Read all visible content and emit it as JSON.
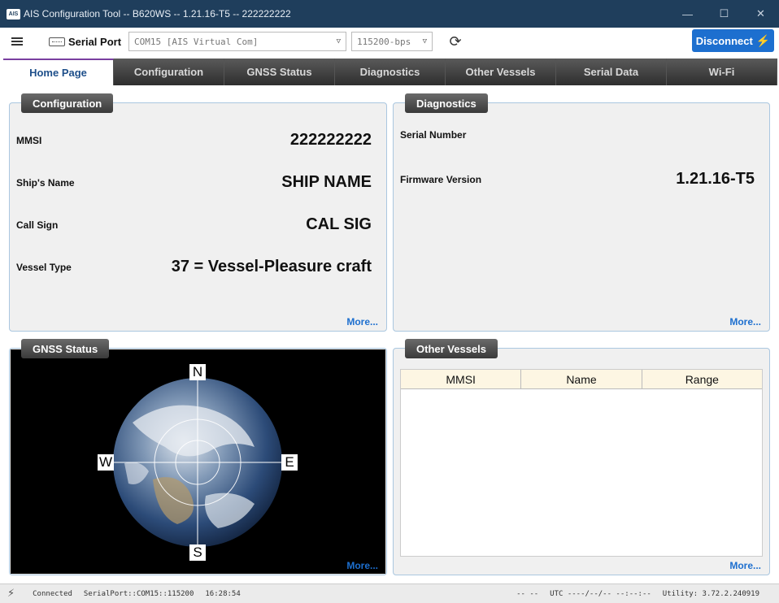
{
  "window": {
    "badge": "AIS",
    "title": "AIS Configuration Tool -- B620WS -- 1.21.16-T5 -- 222222222",
    "minimize": "—",
    "maximize": "☐",
    "close": "✕"
  },
  "toolbar": {
    "port_label": "Serial Port",
    "port_value": "COM15 [AIS Virtual Com]",
    "baud_value": "115200-bps",
    "disconnect_label": "Disconnect"
  },
  "tabs": [
    {
      "label": "Home Page",
      "active": true
    },
    {
      "label": "Configuration"
    },
    {
      "label": "GNSS Status"
    },
    {
      "label": "Diagnostics"
    },
    {
      "label": "Other Vessels"
    },
    {
      "label": "Serial Data"
    },
    {
      "label": "Wi-Fi"
    }
  ],
  "configuration": {
    "header": "Configuration",
    "mmsi_label": "MMSI",
    "mmsi_value": "222222222",
    "ship_name_label": "Ship's Name",
    "ship_name_value": "SHIP NAME",
    "call_sign_label": "Call Sign",
    "call_sign_value": "CAL SIG",
    "vessel_type_label": "Vessel Type",
    "vessel_type_value": "37 = Vessel-Pleasure craft",
    "more": "More..."
  },
  "diagnostics": {
    "header": "Diagnostics",
    "serial_label": "Serial Number",
    "serial_value": "",
    "firmware_label": "Firmware Version",
    "firmware_value": "1.21.16-T5",
    "more": "More..."
  },
  "gnss": {
    "header": "GNSS Status",
    "n": "N",
    "s": "S",
    "e": "E",
    "w": "W",
    "more": "More..."
  },
  "vessels": {
    "header": "Other Vessels",
    "columns": [
      "MMSI",
      "Name",
      "Range"
    ],
    "more": "More..."
  },
  "status": {
    "state": "Connected",
    "port": "SerialPort::COM15::115200",
    "time": "16:28:54",
    "gnss": "-- --",
    "utc": "UTC ----/--/-- --:--:--",
    "utility": "Utility: 3.72.2.240919"
  },
  "colors": {
    "titlebar": "#1f3e5c",
    "accent": "#1d6fcf",
    "panel_border": "#aac7e0"
  }
}
